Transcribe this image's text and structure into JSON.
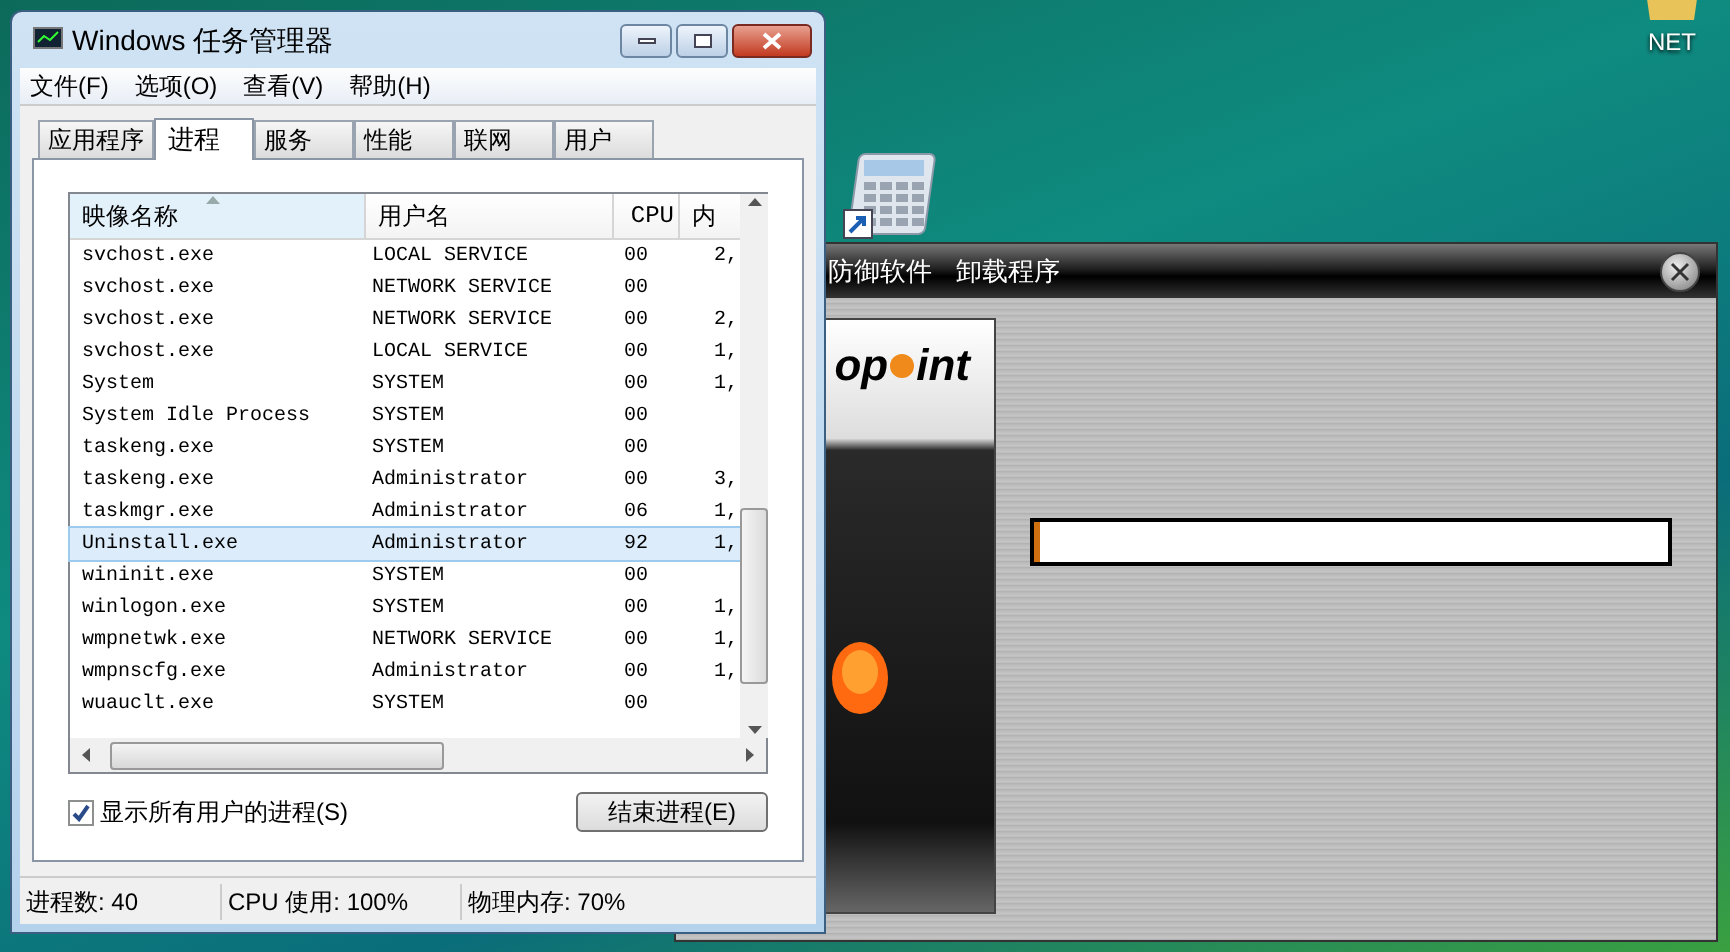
{
  "desktop_icons": [
    {
      "kind": "folder",
      "label": "NET"
    },
    {
      "kind": "calculator"
    }
  ],
  "uninstaller": {
    "title_parts": [
      "防御软件",
      "卸载程序"
    ],
    "logo": [
      "op",
      "int"
    ],
    "progress": {
      "level": 0.01
    }
  },
  "task_manager": {
    "title": "Windows 任务管理器",
    "menu": [
      "文件(F)",
      "选项(O)",
      "查看(V)",
      "帮助(H)"
    ],
    "tabs": [
      {
        "label": "应用程序",
        "selected": false
      },
      {
        "label": "进程",
        "selected": true
      },
      {
        "label": "服务",
        "selected": false
      },
      {
        "label": "性能",
        "selected": false
      },
      {
        "label": "联网",
        "selected": false
      },
      {
        "label": "用户",
        "selected": false
      }
    ],
    "columns": [
      "映像名称",
      "用户名",
      "CPU",
      "内"
    ],
    "rows": [
      {
        "name": "svchost.exe",
        "user": "LOCAL SERVICE",
        "cpu": "00",
        "memory": "2,",
        "selected": false
      },
      {
        "name": "svchost.exe",
        "user": "NETWORK SERVICE",
        "cpu": "00",
        "selected": false
      },
      {
        "name": "svchost.exe",
        "user": "NETWORK SERVICE",
        "cpu": "00",
        "memory": "2,",
        "selected": false
      },
      {
        "name": "svchost.exe",
        "user": "LOCAL SERVICE",
        "cpu": "00",
        "memory": "1,",
        "selected": false
      },
      {
        "name": "System",
        "user": "SYSTEM",
        "cpu": "00",
        "memory": "1,",
        "selected": false
      },
      {
        "name": "System Idle Process",
        "user": "SYSTEM",
        "cpu": "00",
        "selected": false
      },
      {
        "name": "taskeng.exe",
        "user": "SYSTEM",
        "cpu": "00",
        "selected": false
      },
      {
        "name": "taskeng.exe",
        "user": "Administrator",
        "cpu": "00",
        "memory": "3,",
        "selected": false
      },
      {
        "name": "taskmgr.exe",
        "user": "Administrator",
        "cpu": "06",
        "memory": "1,",
        "selected": false
      },
      {
        "name": "Uninstall.exe",
        "user": "Administrator",
        "cpu": "92",
        "memory": "1,",
        "selected": true
      },
      {
        "name": "wininit.exe",
        "user": "SYSTEM",
        "cpu": "00",
        "selected": false
      },
      {
        "name": "winlogon.exe",
        "user": "SYSTEM",
        "cpu": "00",
        "memory": "1,",
        "selected": false
      },
      {
        "name": "wmpnetwk.exe",
        "user": "NETWORK SERVICE",
        "cpu": "00",
        "memory": "1,",
        "selected": false
      },
      {
        "name": "wmpnscfg.exe",
        "user": "Administrator",
        "cpu": "00",
        "memory": "1,",
        "selected": false
      },
      {
        "name": "wuauclt.exe",
        "user": "SYSTEM",
        "cpu": "00",
        "selected": false
      }
    ],
    "show_all_users": {
      "label": "显示所有用户的进程(S)",
      "checked": true
    },
    "end_process_button": "结束进程(E)",
    "status_bar": [
      "进程数: 40",
      "CPU 使用: 100%",
      "物理内存: 70%"
    ]
  }
}
